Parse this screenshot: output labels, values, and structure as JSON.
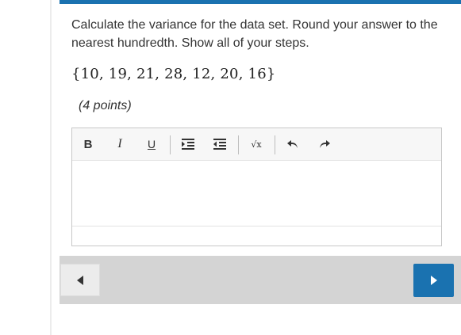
{
  "question": {
    "prompt": "Calculate the variance for the data set. Round your answer to the nearest hundredth. Show all of your steps.",
    "dataset": "{10, 19, 21, 28, 12, 20, 16}",
    "points": "(4 points)"
  },
  "editor": {
    "toolbar": {
      "bold_label": "B",
      "italic_label": "I",
      "underline_label": "U",
      "indent_icon": "indent-icon",
      "outdent_icon": "outdent-icon",
      "math_label": "√x",
      "undo_icon": "undo-icon",
      "redo_icon": "redo-icon"
    },
    "content": ""
  },
  "navigation": {
    "previous_icon": "triangle-left-icon",
    "next_icon": "triangle-right-icon"
  },
  "colors": {
    "accent": "#1a72b0",
    "footer_bg": "#d4d4d4",
    "text": "#333333"
  }
}
